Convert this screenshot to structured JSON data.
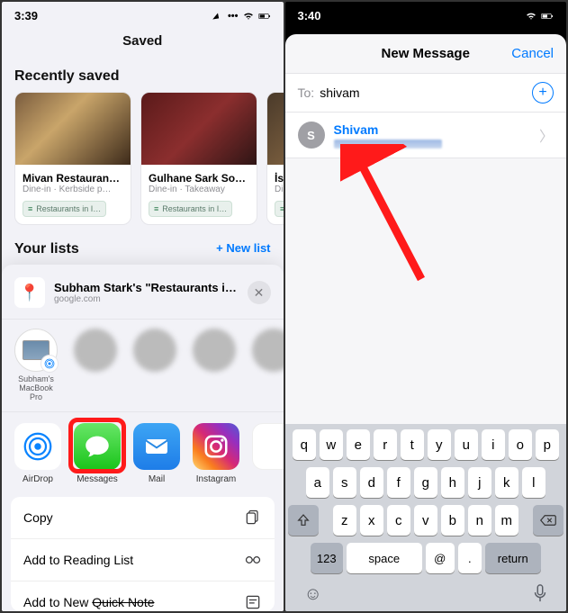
{
  "left": {
    "status": {
      "time": "3:39",
      "icons": "••• ᯤ ▢"
    },
    "title": "Saved",
    "recently_saved": {
      "heading": "Recently saved",
      "cards": [
        {
          "title": "Mivan Restauran…",
          "sub": "Dine-in · Kerbside p…",
          "chip": "Restaurants in I…"
        },
        {
          "title": "Gulhane Sark So…",
          "sub": "Dine-in · Takeaway",
          "chip": "Restaurants in I…"
        },
        {
          "title": "İstan",
          "sub": "Dine-i",
          "chip": "Re"
        }
      ]
    },
    "lists": {
      "heading": "Your lists",
      "new_list": "+  New list"
    },
    "share": {
      "title": "Subham Stark's \"Restaurants in Ist…",
      "sub": "google.com",
      "contacts": [
        {
          "label": "Subham's MacBook Pro",
          "type": "mac"
        },
        {
          "label": "",
          "type": "blur"
        },
        {
          "label": "",
          "type": "blur"
        },
        {
          "label": "",
          "type": "blur"
        },
        {
          "label": "",
          "type": "blur"
        }
      ],
      "apps": [
        {
          "label": "AirDrop",
          "cls": "airdrop"
        },
        {
          "label": "Messages",
          "cls": "messages",
          "highlight": true
        },
        {
          "label": "Mail",
          "cls": "mail"
        },
        {
          "label": "Instagram",
          "cls": "ig"
        },
        {
          "label": "",
          "cls": "notes"
        }
      ],
      "actions": [
        {
          "label": "Copy",
          "icon": "copy"
        },
        {
          "label": "Add to Reading List",
          "icon": "glasses"
        },
        {
          "label_pre": "Add to New ",
          "label_strike": "Quick Note",
          "icon": "note"
        }
      ]
    }
  },
  "right": {
    "status": {
      "time": "3:40",
      "icons": "ᯤ ▢"
    },
    "new_message": {
      "title": "New Message",
      "cancel": "Cancel",
      "to_label": "To:",
      "to_value": "shivam",
      "suggestion": {
        "initial": "S",
        "name": "Shivam"
      }
    },
    "keyboard": {
      "r1": [
        "q",
        "w",
        "e",
        "r",
        "t",
        "y",
        "u",
        "i",
        "o",
        "p"
      ],
      "r2": [
        "a",
        "s",
        "d",
        "f",
        "g",
        "h",
        "j",
        "k",
        "l"
      ],
      "r3": [
        "z",
        "x",
        "c",
        "v",
        "b",
        "n",
        "m"
      ],
      "r4": {
        "num": "123",
        "space": "space",
        "at": "@",
        "dot": ".",
        "return": "return"
      }
    }
  }
}
